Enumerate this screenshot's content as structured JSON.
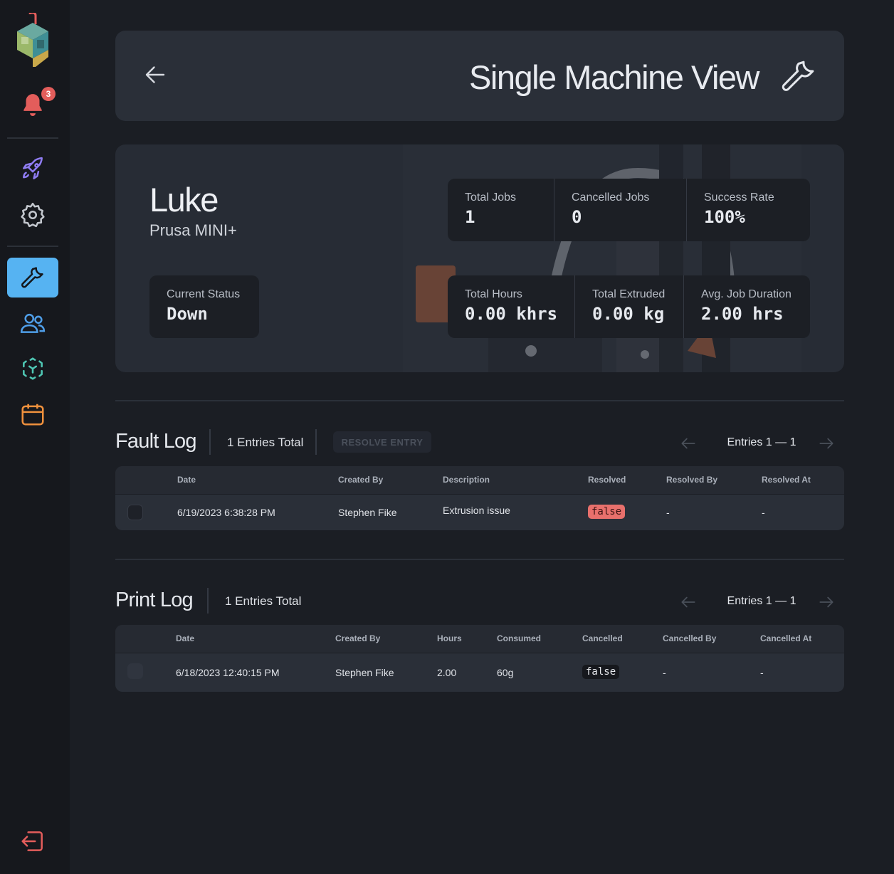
{
  "notifications": {
    "count": "3"
  },
  "header": {
    "title": "Single Machine View"
  },
  "machine": {
    "name": "Luke",
    "model": "Prusa MINI+",
    "status": {
      "label": "Current Status",
      "value": "Down"
    },
    "stats_top": [
      {
        "label": "Total Jobs",
        "value": "1"
      },
      {
        "label": "Cancelled Jobs",
        "value": "0"
      },
      {
        "label": "Success Rate",
        "value": "100%"
      }
    ],
    "stats_bottom": [
      {
        "label": "Total Hours",
        "value": "0.00 khrs"
      },
      {
        "label": "Total Extruded",
        "value": "0.00 kg"
      },
      {
        "label": "Avg. Job Duration",
        "value": "2.00 hrs"
      }
    ]
  },
  "fault_log": {
    "title": "Fault Log",
    "entries_total": "1 Entries Total",
    "resolve_label": "RESOLVE ENTRY",
    "pager": "Entries 1 — 1",
    "columns": [
      "Date",
      "Created By",
      "Description",
      "Resolved",
      "Resolved By",
      "Resolved At"
    ],
    "rows": [
      {
        "date": "6/19/2023 6:38:28 PM",
        "created_by": "Stephen Fike",
        "description": "Extrusion issue",
        "resolved": "false",
        "resolved_by": "-",
        "resolved_at": "-"
      }
    ]
  },
  "print_log": {
    "title": "Print Log",
    "entries_total": "1 Entries Total",
    "pager": "Entries 1 — 1",
    "columns": [
      "Date",
      "Created By",
      "Hours",
      "Consumed",
      "Cancelled",
      "Cancelled By",
      "Cancelled At"
    ],
    "rows": [
      {
        "date": "6/18/2023 12:40:15 PM",
        "created_by": "Stephen Fike",
        "hours": "2.00",
        "consumed": "60g",
        "cancelled": "false",
        "cancelled_by": "-",
        "cancelled_at": "-"
      }
    ]
  },
  "colors": {
    "background": "#1b1e24",
    "sidebar": "#16181d",
    "card": "#272c35",
    "active_nav": "#56b3f2",
    "badge": "#e35d5b",
    "false_resolved": "#e8706c"
  },
  "icons": {
    "sidebar": [
      "logo-icon",
      "bell-icon",
      "rocket-icon",
      "gear-icon",
      "wrench-icon",
      "users-icon",
      "scan-icon",
      "calendar-icon",
      "logout-icon"
    ],
    "header": [
      "back-arrow-icon",
      "wrench-icon"
    ]
  }
}
